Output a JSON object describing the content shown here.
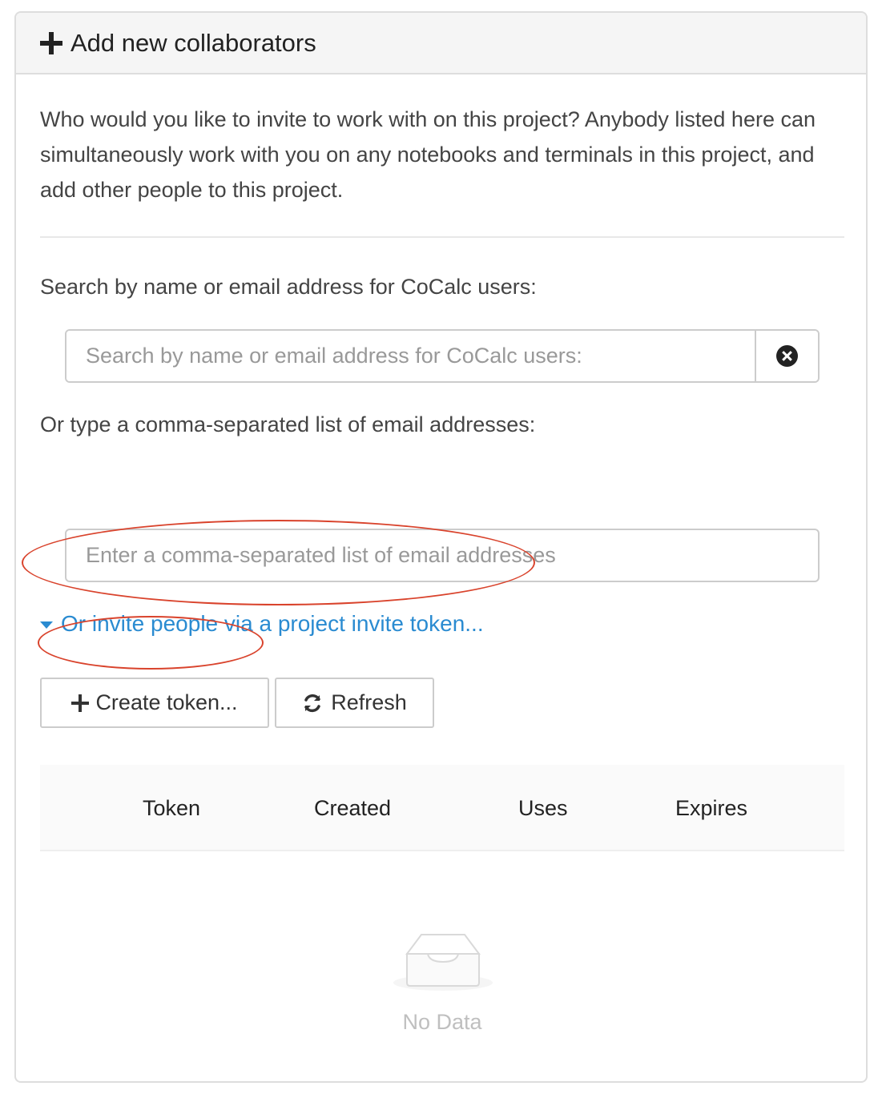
{
  "panel": {
    "title": "Add new collaborators",
    "intro": "Who would you like to invite to work with on this project? Anybody listed here can simultaneously work with you on any notebooks and terminals in this project, and add other people to this project."
  },
  "search": {
    "label": "Search by name or email address for CoCalc users:",
    "placeholder": "Search by name or email address for CoCalc users:",
    "value": ""
  },
  "emails": {
    "label": "Or type a comma-separated list of email addresses:",
    "placeholder": "Enter a comma-separated list of email addresses",
    "value": ""
  },
  "invite_toggle": {
    "label": "Or invite people via a project invite token...",
    "expanded": true
  },
  "buttons": {
    "create_token": "Create token...",
    "refresh": "Refresh"
  },
  "table": {
    "columns": [
      "Token",
      "Created",
      "Uses",
      "Expires"
    ],
    "rows": [],
    "empty_text": "No Data"
  },
  "icons": {
    "header": "plus-icon",
    "clear": "times-circle-icon",
    "toggle": "caret-down-icon",
    "create": "plus-icon",
    "refresh": "refresh-icon",
    "empty": "inbox-icon"
  },
  "colors": {
    "link": "#2a8bd1",
    "annotation": "#d9432c",
    "header_bg": "#f5f5f5",
    "border": "#dddddd"
  }
}
